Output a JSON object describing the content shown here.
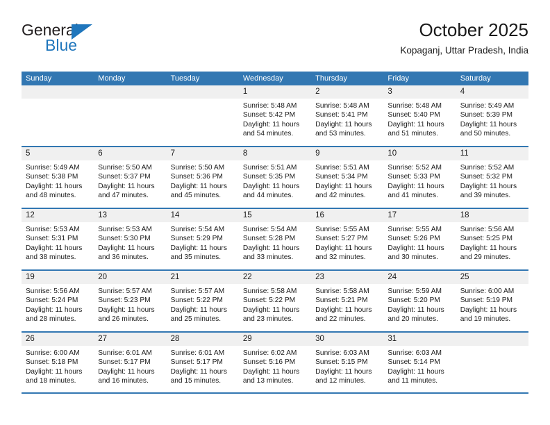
{
  "brand": {
    "name_part1": "General",
    "name_part2": "Blue",
    "triangle_icon": "triangle-logo-icon",
    "accent_color": "#1f76bc"
  },
  "header": {
    "title": "October 2025",
    "location": "Kopaganj, Uttar Pradesh, India"
  },
  "theme": {
    "header_blue": "#3277b2",
    "day_band_gray": "#f0f0f0",
    "text_color": "#1a1a1a"
  },
  "labels": {
    "sunrise_prefix": "Sunrise:",
    "sunset_prefix": "Sunset:",
    "daylight_prefix": "Daylight:"
  },
  "weekday_headers": [
    "Sunday",
    "Monday",
    "Tuesday",
    "Wednesday",
    "Thursday",
    "Friday",
    "Saturday"
  ],
  "weeks": [
    [
      {
        "day": "",
        "empty": true
      },
      {
        "day": "",
        "empty": true
      },
      {
        "day": "",
        "empty": true
      },
      {
        "day": "1",
        "sunrise": "Sunrise: 5:48 AM",
        "sunset": "Sunset: 5:42 PM",
        "daylight": "Daylight: 11 hours and 54 minutes."
      },
      {
        "day": "2",
        "sunrise": "Sunrise: 5:48 AM",
        "sunset": "Sunset: 5:41 PM",
        "daylight": "Daylight: 11 hours and 53 minutes."
      },
      {
        "day": "3",
        "sunrise": "Sunrise: 5:48 AM",
        "sunset": "Sunset: 5:40 PM",
        "daylight": "Daylight: 11 hours and 51 minutes."
      },
      {
        "day": "4",
        "sunrise": "Sunrise: 5:49 AM",
        "sunset": "Sunset: 5:39 PM",
        "daylight": "Daylight: 11 hours and 50 minutes."
      }
    ],
    [
      {
        "day": "5",
        "sunrise": "Sunrise: 5:49 AM",
        "sunset": "Sunset: 5:38 PM",
        "daylight": "Daylight: 11 hours and 48 minutes."
      },
      {
        "day": "6",
        "sunrise": "Sunrise: 5:50 AM",
        "sunset": "Sunset: 5:37 PM",
        "daylight": "Daylight: 11 hours and 47 minutes."
      },
      {
        "day": "7",
        "sunrise": "Sunrise: 5:50 AM",
        "sunset": "Sunset: 5:36 PM",
        "daylight": "Daylight: 11 hours and 45 minutes."
      },
      {
        "day": "8",
        "sunrise": "Sunrise: 5:51 AM",
        "sunset": "Sunset: 5:35 PM",
        "daylight": "Daylight: 11 hours and 44 minutes."
      },
      {
        "day": "9",
        "sunrise": "Sunrise: 5:51 AM",
        "sunset": "Sunset: 5:34 PM",
        "daylight": "Daylight: 11 hours and 42 minutes."
      },
      {
        "day": "10",
        "sunrise": "Sunrise: 5:52 AM",
        "sunset": "Sunset: 5:33 PM",
        "daylight": "Daylight: 11 hours and 41 minutes."
      },
      {
        "day": "11",
        "sunrise": "Sunrise: 5:52 AM",
        "sunset": "Sunset: 5:32 PM",
        "daylight": "Daylight: 11 hours and 39 minutes."
      }
    ],
    [
      {
        "day": "12",
        "sunrise": "Sunrise: 5:53 AM",
        "sunset": "Sunset: 5:31 PM",
        "daylight": "Daylight: 11 hours and 38 minutes."
      },
      {
        "day": "13",
        "sunrise": "Sunrise: 5:53 AM",
        "sunset": "Sunset: 5:30 PM",
        "daylight": "Daylight: 11 hours and 36 minutes."
      },
      {
        "day": "14",
        "sunrise": "Sunrise: 5:54 AM",
        "sunset": "Sunset: 5:29 PM",
        "daylight": "Daylight: 11 hours and 35 minutes."
      },
      {
        "day": "15",
        "sunrise": "Sunrise: 5:54 AM",
        "sunset": "Sunset: 5:28 PM",
        "daylight": "Daylight: 11 hours and 33 minutes."
      },
      {
        "day": "16",
        "sunrise": "Sunrise: 5:55 AM",
        "sunset": "Sunset: 5:27 PM",
        "daylight": "Daylight: 11 hours and 32 minutes."
      },
      {
        "day": "17",
        "sunrise": "Sunrise: 5:55 AM",
        "sunset": "Sunset: 5:26 PM",
        "daylight": "Daylight: 11 hours and 30 minutes."
      },
      {
        "day": "18",
        "sunrise": "Sunrise: 5:56 AM",
        "sunset": "Sunset: 5:25 PM",
        "daylight": "Daylight: 11 hours and 29 minutes."
      }
    ],
    [
      {
        "day": "19",
        "sunrise": "Sunrise: 5:56 AM",
        "sunset": "Sunset: 5:24 PM",
        "daylight": "Daylight: 11 hours and 28 minutes."
      },
      {
        "day": "20",
        "sunrise": "Sunrise: 5:57 AM",
        "sunset": "Sunset: 5:23 PM",
        "daylight": "Daylight: 11 hours and 26 minutes."
      },
      {
        "day": "21",
        "sunrise": "Sunrise: 5:57 AM",
        "sunset": "Sunset: 5:22 PM",
        "daylight": "Daylight: 11 hours and 25 minutes."
      },
      {
        "day": "22",
        "sunrise": "Sunrise: 5:58 AM",
        "sunset": "Sunset: 5:22 PM",
        "daylight": "Daylight: 11 hours and 23 minutes."
      },
      {
        "day": "23",
        "sunrise": "Sunrise: 5:58 AM",
        "sunset": "Sunset: 5:21 PM",
        "daylight": "Daylight: 11 hours and 22 minutes."
      },
      {
        "day": "24",
        "sunrise": "Sunrise: 5:59 AM",
        "sunset": "Sunset: 5:20 PM",
        "daylight": "Daylight: 11 hours and 20 minutes."
      },
      {
        "day": "25",
        "sunrise": "Sunrise: 6:00 AM",
        "sunset": "Sunset: 5:19 PM",
        "daylight": "Daylight: 11 hours and 19 minutes."
      }
    ],
    [
      {
        "day": "26",
        "sunrise": "Sunrise: 6:00 AM",
        "sunset": "Sunset: 5:18 PM",
        "daylight": "Daylight: 11 hours and 18 minutes."
      },
      {
        "day": "27",
        "sunrise": "Sunrise: 6:01 AM",
        "sunset": "Sunset: 5:17 PM",
        "daylight": "Daylight: 11 hours and 16 minutes."
      },
      {
        "day": "28",
        "sunrise": "Sunrise: 6:01 AM",
        "sunset": "Sunset: 5:17 PM",
        "daylight": "Daylight: 11 hours and 15 minutes."
      },
      {
        "day": "29",
        "sunrise": "Sunrise: 6:02 AM",
        "sunset": "Sunset: 5:16 PM",
        "daylight": "Daylight: 11 hours and 13 minutes."
      },
      {
        "day": "30",
        "sunrise": "Sunrise: 6:03 AM",
        "sunset": "Sunset: 5:15 PM",
        "daylight": "Daylight: 11 hours and 12 minutes."
      },
      {
        "day": "31",
        "sunrise": "Sunrise: 6:03 AM",
        "sunset": "Sunset: 5:14 PM",
        "daylight": "Daylight: 11 hours and 11 minutes."
      },
      {
        "day": "",
        "empty": true
      }
    ]
  ]
}
